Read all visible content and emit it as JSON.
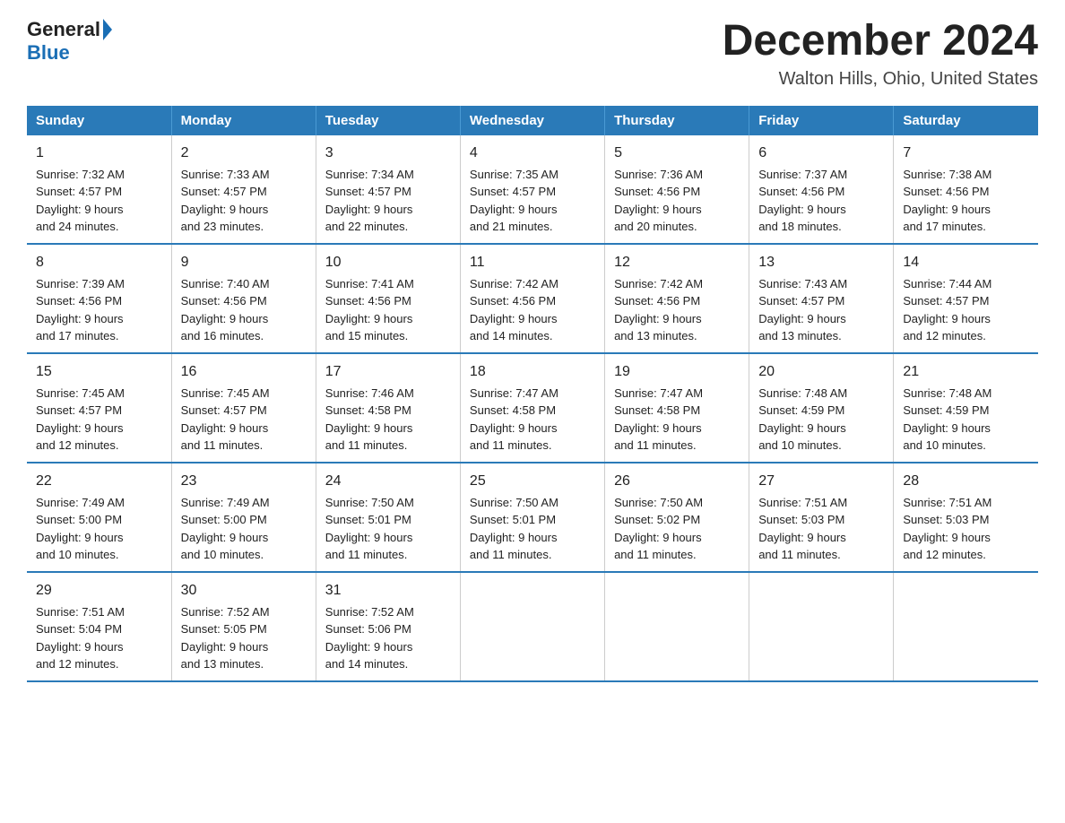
{
  "logo": {
    "general": "General",
    "blue": "Blue"
  },
  "header": {
    "title": "December 2024",
    "subtitle": "Walton Hills, Ohio, United States"
  },
  "weekdays": [
    "Sunday",
    "Monday",
    "Tuesday",
    "Wednesday",
    "Thursday",
    "Friday",
    "Saturday"
  ],
  "weeks": [
    [
      {
        "day": "1",
        "sunrise": "7:32 AM",
        "sunset": "4:57 PM",
        "daylight": "9 hours and 24 minutes."
      },
      {
        "day": "2",
        "sunrise": "7:33 AM",
        "sunset": "4:57 PM",
        "daylight": "9 hours and 23 minutes."
      },
      {
        "day": "3",
        "sunrise": "7:34 AM",
        "sunset": "4:57 PM",
        "daylight": "9 hours and 22 minutes."
      },
      {
        "day": "4",
        "sunrise": "7:35 AM",
        "sunset": "4:57 PM",
        "daylight": "9 hours and 21 minutes."
      },
      {
        "day": "5",
        "sunrise": "7:36 AM",
        "sunset": "4:56 PM",
        "daylight": "9 hours and 20 minutes."
      },
      {
        "day": "6",
        "sunrise": "7:37 AM",
        "sunset": "4:56 PM",
        "daylight": "9 hours and 18 minutes."
      },
      {
        "day": "7",
        "sunrise": "7:38 AM",
        "sunset": "4:56 PM",
        "daylight": "9 hours and 17 minutes."
      }
    ],
    [
      {
        "day": "8",
        "sunrise": "7:39 AM",
        "sunset": "4:56 PM",
        "daylight": "9 hours and 17 minutes."
      },
      {
        "day": "9",
        "sunrise": "7:40 AM",
        "sunset": "4:56 PM",
        "daylight": "9 hours and 16 minutes."
      },
      {
        "day": "10",
        "sunrise": "7:41 AM",
        "sunset": "4:56 PM",
        "daylight": "9 hours and 15 minutes."
      },
      {
        "day": "11",
        "sunrise": "7:42 AM",
        "sunset": "4:56 PM",
        "daylight": "9 hours and 14 minutes."
      },
      {
        "day": "12",
        "sunrise": "7:42 AM",
        "sunset": "4:56 PM",
        "daylight": "9 hours and 13 minutes."
      },
      {
        "day": "13",
        "sunrise": "7:43 AM",
        "sunset": "4:57 PM",
        "daylight": "9 hours and 13 minutes."
      },
      {
        "day": "14",
        "sunrise": "7:44 AM",
        "sunset": "4:57 PM",
        "daylight": "9 hours and 12 minutes."
      }
    ],
    [
      {
        "day": "15",
        "sunrise": "7:45 AM",
        "sunset": "4:57 PM",
        "daylight": "9 hours and 12 minutes."
      },
      {
        "day": "16",
        "sunrise": "7:45 AM",
        "sunset": "4:57 PM",
        "daylight": "9 hours and 11 minutes."
      },
      {
        "day": "17",
        "sunrise": "7:46 AM",
        "sunset": "4:58 PM",
        "daylight": "9 hours and 11 minutes."
      },
      {
        "day": "18",
        "sunrise": "7:47 AM",
        "sunset": "4:58 PM",
        "daylight": "9 hours and 11 minutes."
      },
      {
        "day": "19",
        "sunrise": "7:47 AM",
        "sunset": "4:58 PM",
        "daylight": "9 hours and 11 minutes."
      },
      {
        "day": "20",
        "sunrise": "7:48 AM",
        "sunset": "4:59 PM",
        "daylight": "9 hours and 10 minutes."
      },
      {
        "day": "21",
        "sunrise": "7:48 AM",
        "sunset": "4:59 PM",
        "daylight": "9 hours and 10 minutes."
      }
    ],
    [
      {
        "day": "22",
        "sunrise": "7:49 AM",
        "sunset": "5:00 PM",
        "daylight": "9 hours and 10 minutes."
      },
      {
        "day": "23",
        "sunrise": "7:49 AM",
        "sunset": "5:00 PM",
        "daylight": "9 hours and 10 minutes."
      },
      {
        "day": "24",
        "sunrise": "7:50 AM",
        "sunset": "5:01 PM",
        "daylight": "9 hours and 11 minutes."
      },
      {
        "day": "25",
        "sunrise": "7:50 AM",
        "sunset": "5:01 PM",
        "daylight": "9 hours and 11 minutes."
      },
      {
        "day": "26",
        "sunrise": "7:50 AM",
        "sunset": "5:02 PM",
        "daylight": "9 hours and 11 minutes."
      },
      {
        "day": "27",
        "sunrise": "7:51 AM",
        "sunset": "5:03 PM",
        "daylight": "9 hours and 11 minutes."
      },
      {
        "day": "28",
        "sunrise": "7:51 AM",
        "sunset": "5:03 PM",
        "daylight": "9 hours and 12 minutes."
      }
    ],
    [
      {
        "day": "29",
        "sunrise": "7:51 AM",
        "sunset": "5:04 PM",
        "daylight": "9 hours and 12 minutes."
      },
      {
        "day": "30",
        "sunrise": "7:52 AM",
        "sunset": "5:05 PM",
        "daylight": "9 hours and 13 minutes."
      },
      {
        "day": "31",
        "sunrise": "7:52 AM",
        "sunset": "5:06 PM",
        "daylight": "9 hours and 14 minutes."
      },
      null,
      null,
      null,
      null
    ]
  ],
  "labels": {
    "sunrise": "Sunrise:",
    "sunset": "Sunset:",
    "daylight": "Daylight:"
  }
}
